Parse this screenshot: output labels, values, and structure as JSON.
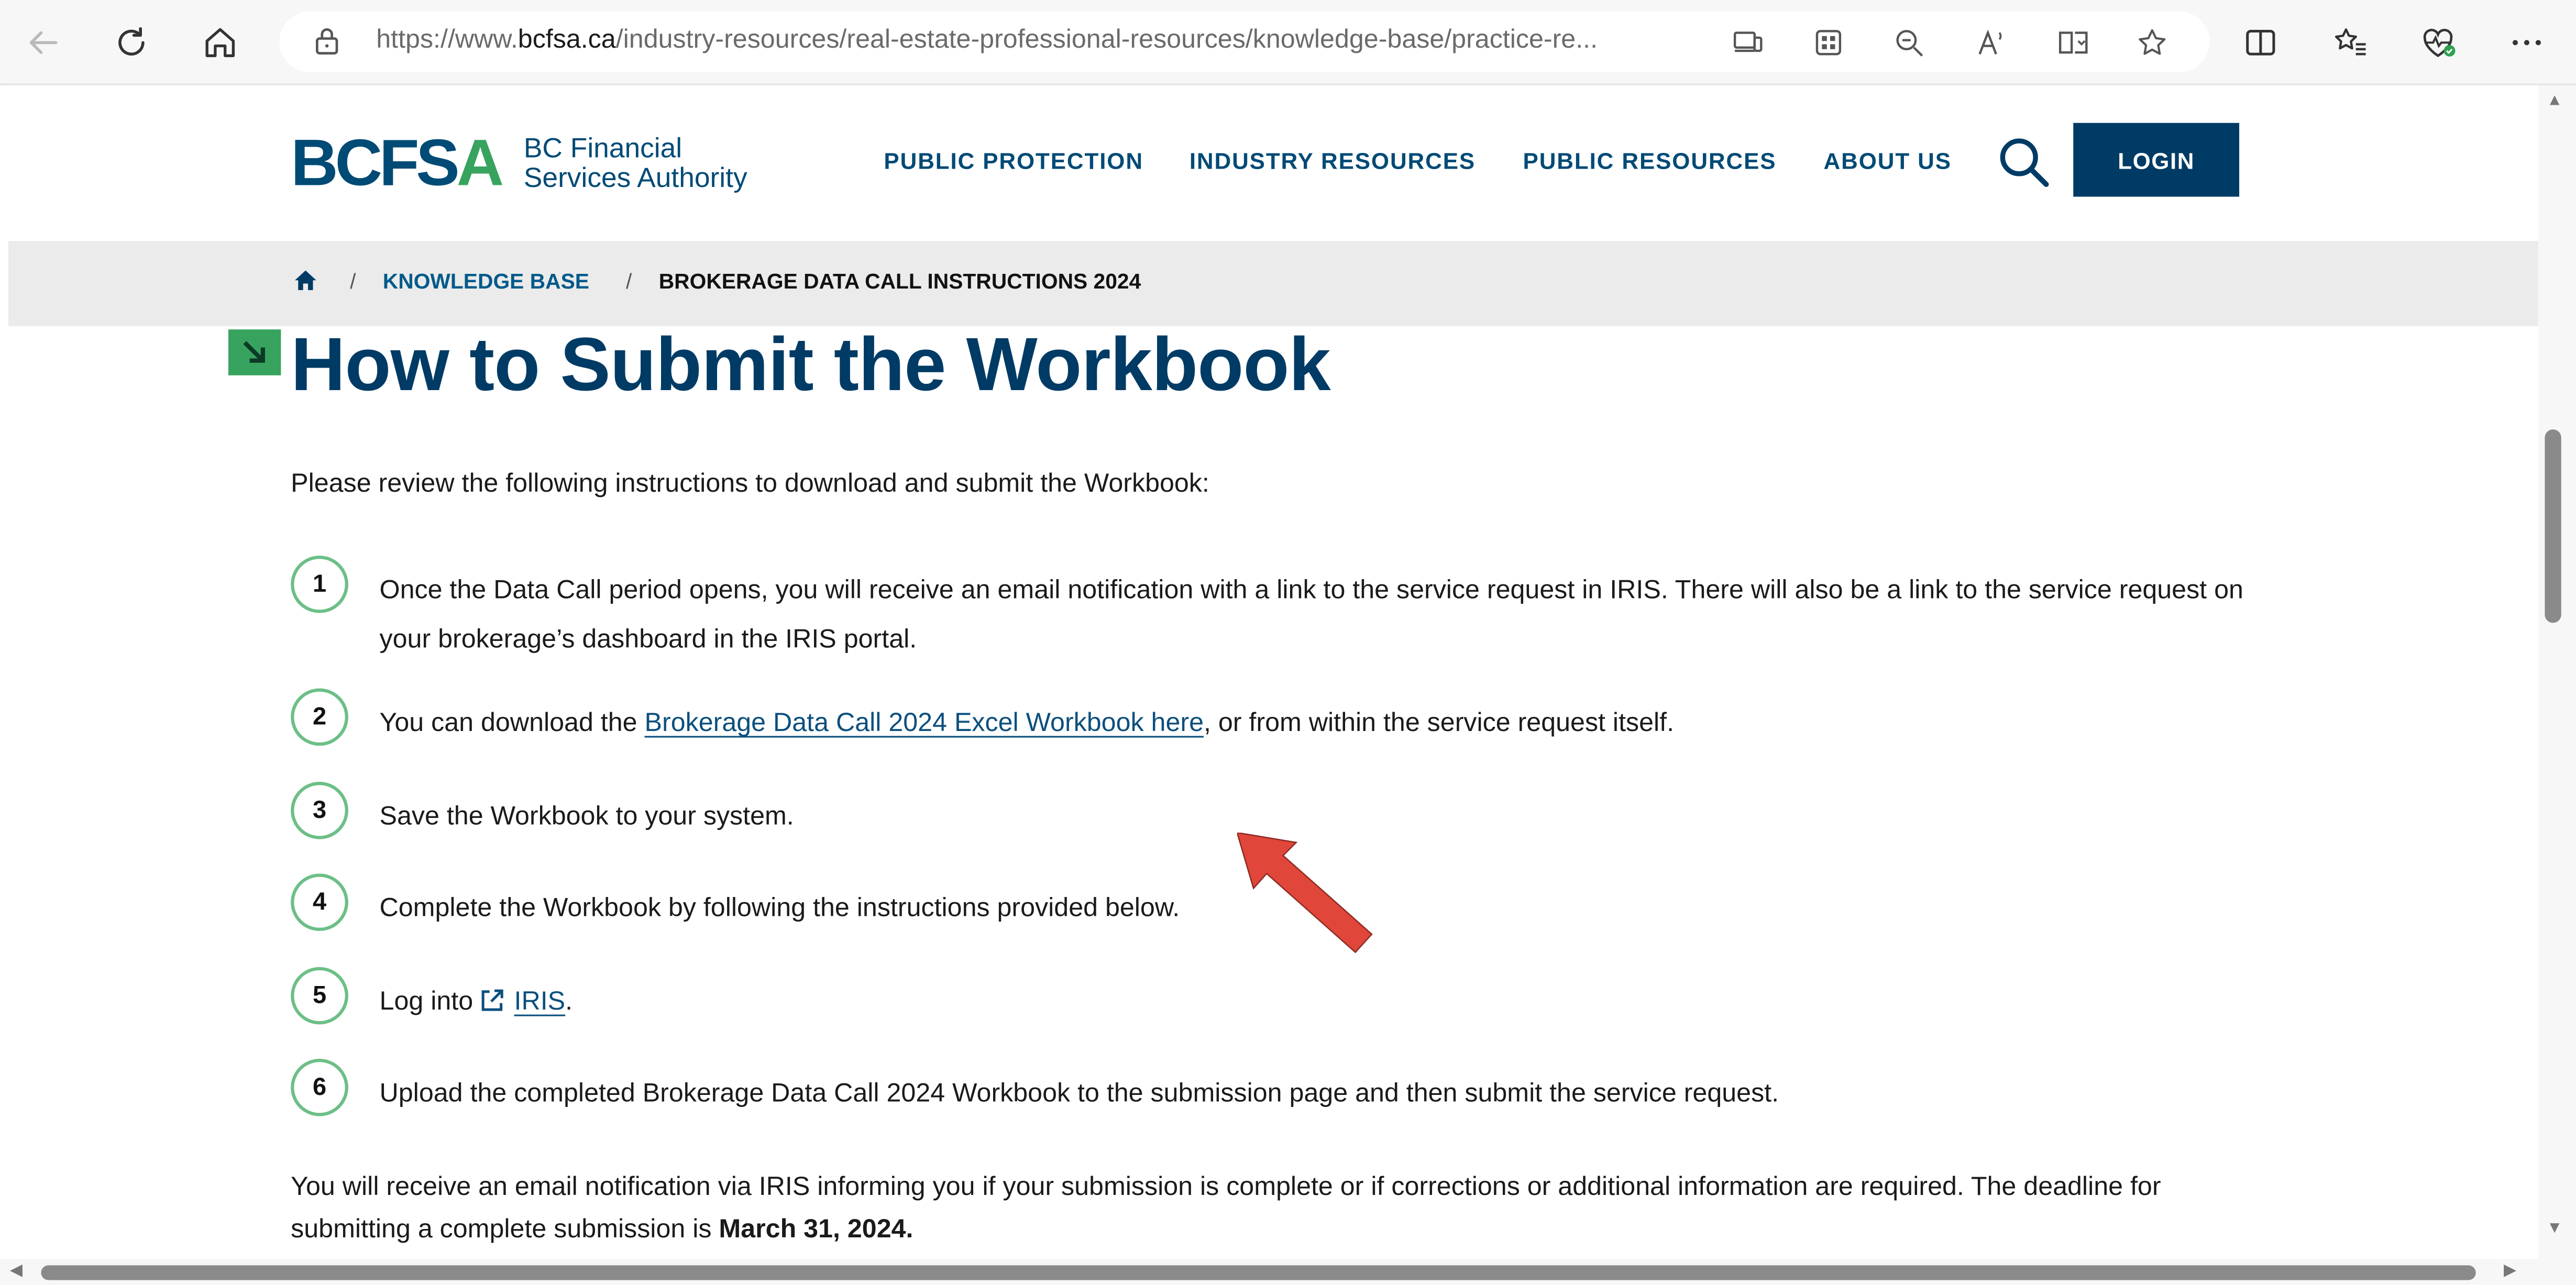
{
  "browser": {
    "url_prefix": "https://www.",
    "url_domain": "bcfsa.ca",
    "url_path": "/industry-resources/real-estate-professional-resources/knowledge-base/practice-re..."
  },
  "header": {
    "logo_mark_main": "BCFS",
    "logo_mark_accent": "A",
    "logo_line1": "BC Financial",
    "logo_line2": "Services Authority",
    "nav": [
      "PUBLIC PROTECTION",
      "INDUSTRY RESOURCES",
      "PUBLIC RESOURCES",
      "ABOUT US"
    ],
    "login_label": "LOGIN"
  },
  "breadcrumb": {
    "items": [
      "KNOWLEDGE BASE",
      "BROKERAGE DATA CALL INSTRUCTIONS 2024"
    ],
    "separator": "/"
  },
  "content": {
    "title": "How to Submit the Workbook",
    "intro": "Please review the following instructions to download and submit the Workbook:",
    "steps": [
      {
        "num": "1",
        "text": "Once the Data Call period opens, you will receive an email notification with a link to the service request in IRIS. There will also be a link to the service request on your brokerage’s dashboard in the IRIS portal."
      },
      {
        "num": "2",
        "text_before": "You can download the ",
        "link": "Brokerage Data Call 2024 Excel Workbook here",
        "text_after": ", or from within the service request itself."
      },
      {
        "num": "3",
        "text": "Save the Workbook to your system."
      },
      {
        "num": "4",
        "text": "Complete the Workbook by following the instructions provided below."
      },
      {
        "num": "5",
        "text_before": "Log into",
        "link": "IRIS",
        "text_after": "."
      },
      {
        "num": "6",
        "text": "Upload the completed Brokerage Data Call 2024 Workbook to the submission page and then submit the service request."
      }
    ],
    "outro_text": "You will receive an email notification via IRIS informing you if your submission is complete or if corrections or additional information are required. The deadline for submitting a complete submission is ",
    "outro_bold": "March 31, 2024."
  },
  "colors": {
    "brand_navy": "#003b65",
    "brand_green": "#37a35f",
    "annotation_red": "#e0463a"
  }
}
